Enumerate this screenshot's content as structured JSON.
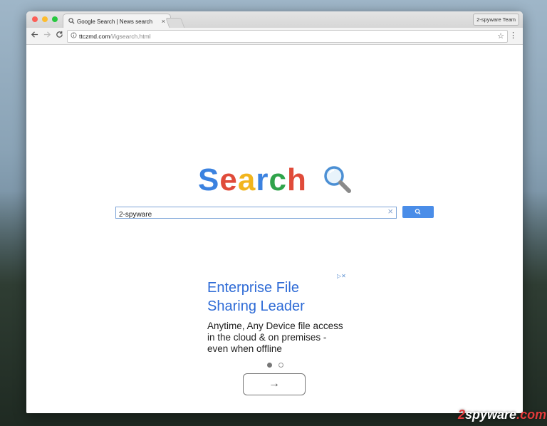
{
  "browser": {
    "tab_title": "Google Search | News search",
    "tab_favicon": "search-icon",
    "tab_close": "×",
    "profile_label": "2-spyware Team",
    "url_host": "ttczmd.com",
    "url_path": "/i/igsearch.html"
  },
  "page": {
    "logo_letters": [
      "S",
      "e",
      "a",
      "r",
      "c",
      "h"
    ],
    "logo_colors": [
      "#3b82e0",
      "#e04b3a",
      "#f2b51d",
      "#3b82e0",
      "#2fa34a",
      "#e04b3a"
    ],
    "search_value": "2-spyware",
    "clear_glyph": "×"
  },
  "ad": {
    "adchoices": "▷✕",
    "headline": "Enterprise File Sharing Leader",
    "body": "Anytime, Any Device file access in the cloud & on premises - even when offline",
    "next_glyph": "→"
  },
  "watermark": {
    "prefix": "2",
    "brand": "spyware",
    "suffix": ".com"
  },
  "colors": {
    "accent": "#4a8de8",
    "ad_link": "#2e6bd6"
  }
}
